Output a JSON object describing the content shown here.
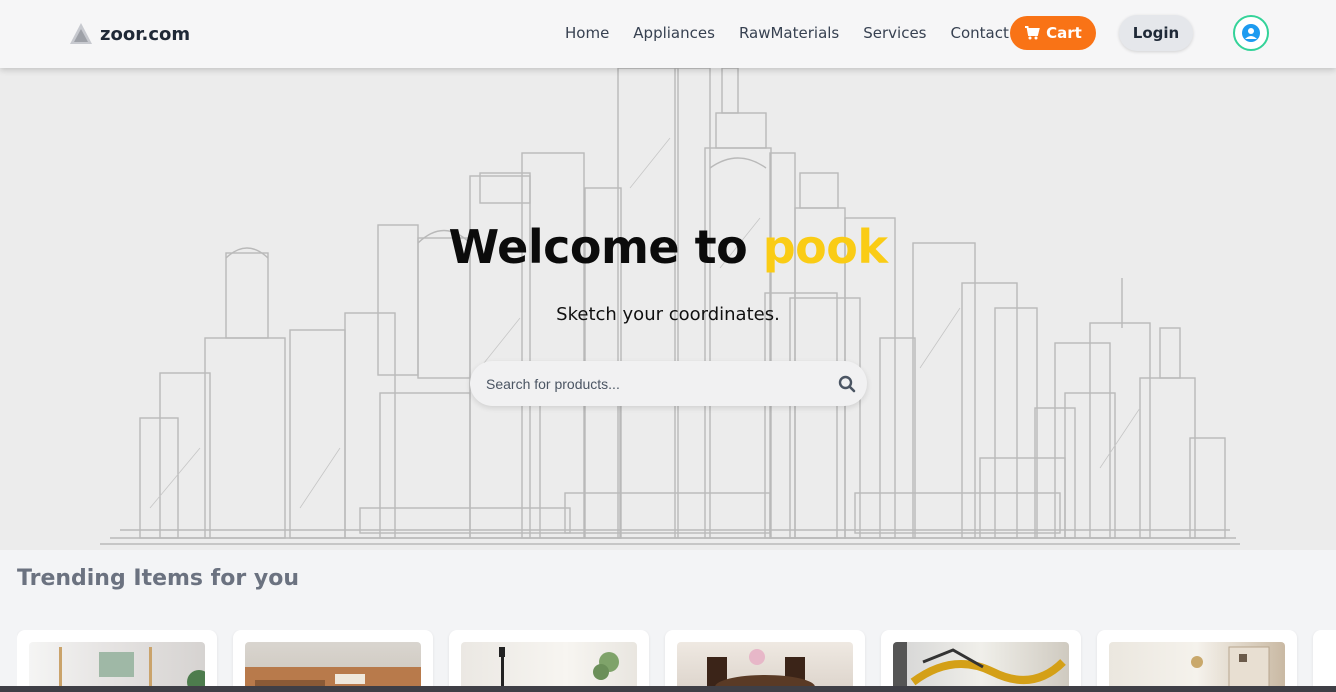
{
  "brand": {
    "name": "zoor.com"
  },
  "nav": {
    "links": [
      "Home",
      "Appliances",
      "RawMaterials",
      "Services",
      "Contact"
    ],
    "cart_label": "Cart",
    "login_label": "Login"
  },
  "hero": {
    "title_prefix": "Welcome to ",
    "title_highlight": "pook",
    "subtitle": "Sketch your coordinates.",
    "search_placeholder": "Search for products..."
  },
  "trending": {
    "title": "Trending Items for you",
    "items": [
      {
        "image": "living-room-shelves"
      },
      {
        "image": "leather-sofa"
      },
      {
        "image": "floor-lamp-plant"
      },
      {
        "image": "dining-table-chairs"
      },
      {
        "image": "abstract-gold-art"
      },
      {
        "image": "bright-interior-shelf"
      }
    ]
  },
  "colors": {
    "accent_orange": "#f97316",
    "highlight_yellow": "#facc15",
    "avatar_ring": "#34d399"
  }
}
